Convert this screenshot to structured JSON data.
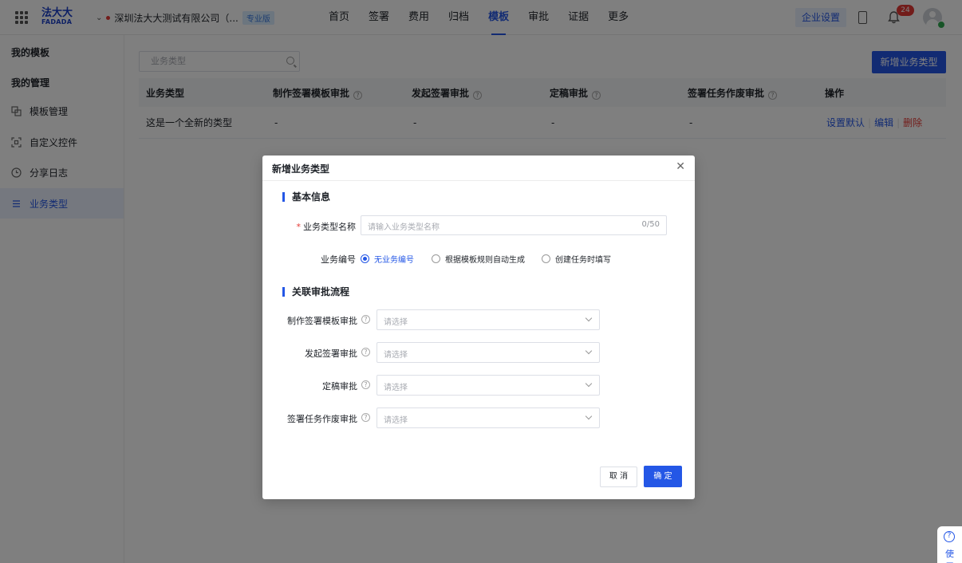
{
  "topbar": {
    "logo_cn": "法大大",
    "logo_en": "FADADA",
    "company": "深圳法大大测试有限公司（...",
    "edition_badge": "专业版",
    "nav": [
      "首页",
      "签署",
      "费用",
      "归档",
      "模板",
      "审批",
      "证据",
      "更多"
    ],
    "active_nav": "模板",
    "enterprise_settings": "企业设置",
    "notification_count": "24"
  },
  "sidebar": {
    "group_my_templates": "我的模板",
    "group_my_management": "我的管理",
    "items": [
      {
        "label": "模板管理",
        "icon": "template-icon"
      },
      {
        "label": "自定义控件",
        "icon": "control-icon"
      },
      {
        "label": "分享日志",
        "icon": "clock-icon"
      },
      {
        "label": "业务类型",
        "icon": "list-icon",
        "active": true
      }
    ]
  },
  "main": {
    "search_placeholder": "业务类型",
    "add_button": "新增业务类型",
    "columns": [
      "业务类型",
      "制作签署模板审批",
      "发起签署审批",
      "定稿审批",
      "签署任务作废审批",
      "操作"
    ],
    "rows": [
      {
        "type": "这是一个全新的类型",
        "template_approval": "-",
        "sign_approval": "-",
        "final_approval": "-",
        "void_approval": "-",
        "actions": [
          "设置默认",
          "编辑",
          "删除"
        ]
      }
    ]
  },
  "dialog": {
    "title": "新增业务类型",
    "section_basic": "基本信息",
    "name_label": "业务类型名称",
    "name_placeholder": "请输入业务类型名称",
    "name_counter": "0/50",
    "number_label": "业务编号",
    "number_options": [
      "无业务编号",
      "根据模板规则自动生成",
      "创建任务时填写"
    ],
    "number_selected": "无业务编号",
    "section_approval": "关联审批流程",
    "approval_fields": [
      {
        "label": "制作签署模板审批",
        "placeholder": "请选择"
      },
      {
        "label": "发起签署审批",
        "placeholder": "请选择"
      },
      {
        "label": "定稿审批",
        "placeholder": "请选择"
      },
      {
        "label": "签署任务作废审批",
        "placeholder": "请选择"
      }
    ],
    "cancel": "取 消",
    "confirm": "确 定"
  },
  "help": {
    "label": "使用"
  },
  "colors": {
    "primary": "#2457e6",
    "danger": "#e53935"
  }
}
